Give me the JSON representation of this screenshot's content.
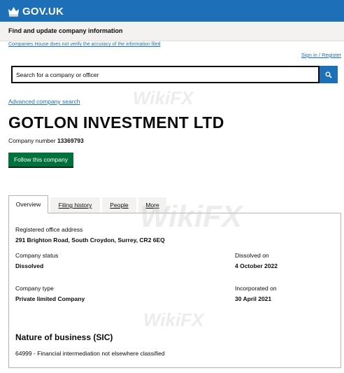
{
  "header": {
    "logo_text": "GOV.UK",
    "accent": "#1d70b8"
  },
  "service": {
    "name": "Find and update company information"
  },
  "disclaimer": "Companies House does not verify the accuracy of the information filed",
  "sign_in": "Sign in / Register",
  "search": {
    "placeholder": "Search for a company or officer",
    "icon": "search-icon"
  },
  "advanced_search": "Advanced company search",
  "company": {
    "name": "GOTLON INVESTMENT LTD",
    "number_label": "Company number",
    "number": "13369793"
  },
  "follow_button": "Follow this company",
  "follow_color": "#00703c",
  "tabs": [
    {
      "label": "Overview",
      "active": true
    },
    {
      "label": "Filing history",
      "active": false
    },
    {
      "label": "People",
      "active": false
    },
    {
      "label": "More",
      "active": false
    }
  ],
  "overview": {
    "registered_office_label": "Registered office address",
    "registered_office": "291 Brighton Road, South Croydon, Surrey, CR2 6EQ",
    "status_label": "Company status",
    "status": "Dissolved",
    "dissolved_label": "Dissolved on",
    "dissolved": "4 October 2022",
    "type_label": "Company type",
    "type": "Private limited Company",
    "incorporated_label": "Incorporated on",
    "incorporated": "30 April 2021",
    "sic_heading": "Nature of business (SIC)",
    "sic": "64999 - Financial intermediation not elsewhere classified"
  },
  "watermark": "WikiFX"
}
